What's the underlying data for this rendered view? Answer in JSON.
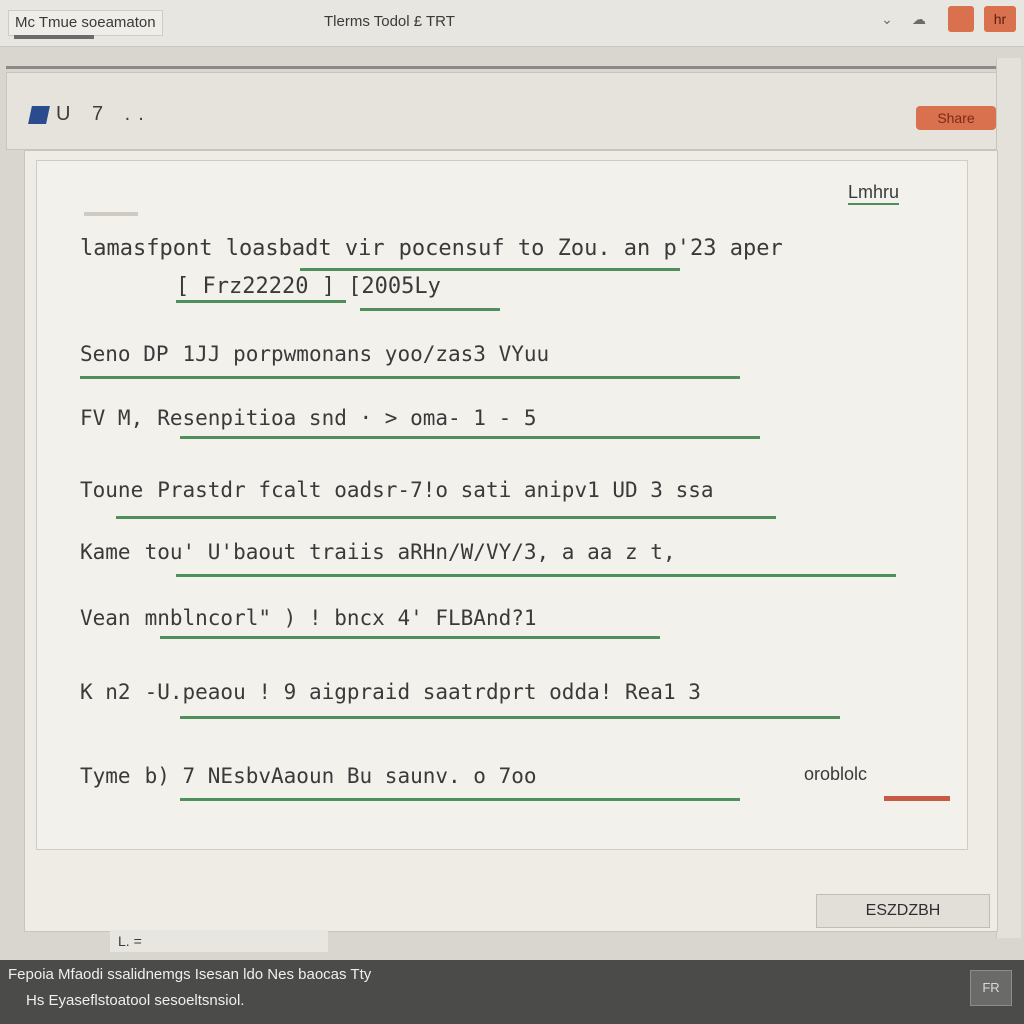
{
  "window": {
    "app_title": "Mc Tmue soeamaton",
    "doc_title": "Tlerms Todol £ TRT",
    "controls": {
      "chevron_icon": "chevron-down-icon",
      "cloud_icon": "cloud-icon",
      "minimize_icon": "minimize-icon",
      "close_label": "hr"
    }
  },
  "toolbar": {
    "icons_label": "U 7 ..",
    "action_label": "Share"
  },
  "document": {
    "badge": "Lmhru",
    "lines": [
      {
        "label": "lamasfpont loasbadt vir",
        "value": "pocensuf to Zou. an p'23 aper"
      },
      {
        "label": "",
        "value": "[ Frz22220 ] [2005Ly"
      },
      {
        "label": "Seno DP",
        "value": "1JJ porpwmonans yoo/zas3 VYuu"
      },
      {
        "label": "FV M,",
        "value": "Resenpitioa snd · > oma- 1 - 5"
      },
      {
        "label": "Toune",
        "value": "Prastdr fcalt oadsr-7!o sati anipv1 UD 3 ssa"
      },
      {
        "label": "Kame",
        "value": "tou' U'baout traiis aRHn/W/VY/3, a aa z t,"
      },
      {
        "label": "Vean",
        "value": "mnblncorl\" ) ! bncx 4' FLBAnd?1"
      },
      {
        "label": "K n2",
        "value": "-U.peaou ! 9 aigpraid saatrdprt odda! Rea1 3"
      },
      {
        "label": "Tyme",
        "value": "b) 7 NEsbvAaoun Bu saunv. o 7oo"
      }
    ],
    "right_note": "oroblolc"
  },
  "footer": {
    "button_label": "ESZDZBH",
    "left_label": "L. ="
  },
  "statusbar": {
    "line1": "Fepoia Mfaodi ssalidnemgs Isesan ldo Nes baocas Tty",
    "line2": "Hs Eyaseflstoatool sesoeltsnsiol.",
    "icon_label": "FR"
  }
}
